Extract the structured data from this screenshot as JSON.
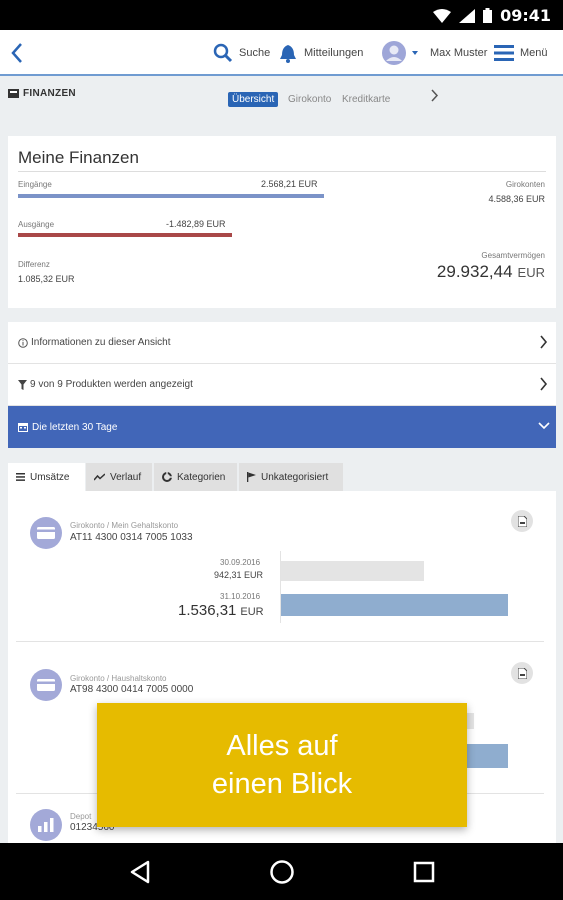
{
  "status_bar": {
    "time": "09:41"
  },
  "header": {
    "search_label": "Suche",
    "messages_label": "Mitteilungen",
    "user_name": "Max Muster",
    "menu_label": "Menü"
  },
  "subnav": {
    "section_label": "FINANZEN",
    "tabs": [
      "Übersicht",
      "Girokonto",
      "Kreditkarte"
    ]
  },
  "overview": {
    "title": "Meine Finanzen",
    "income_label": "Eingänge",
    "income_value": "2.568,21 EUR",
    "expenses_label": "Ausgänge",
    "expenses_value": "-1.482,89 EUR",
    "difference_label": "Differenz",
    "difference_value": "1.085,32 EUR",
    "giro_label": "Girokonten",
    "giro_value": "4.588,36 EUR",
    "total_label": "Gesamtvermögen",
    "total_value": "29.932,44",
    "total_currency": "EUR"
  },
  "rows": {
    "info": "Informationen zu dieser Ansicht",
    "products": "9 von 9 Produkten werden angezeigt",
    "period": "Die letzten 30 Tage"
  },
  "content_tabs": [
    "Umsätze",
    "Verlauf",
    "Kategorien",
    "Unkategorisiert"
  ],
  "accounts": [
    {
      "type": "Girokonto / Mein Gehaltskonto",
      "iban": "AT11 4300 0314 7005 1033",
      "prev_date": "30.09.2016",
      "prev_value": "942,31 EUR",
      "curr_date": "31.10.2016",
      "curr_value": "1.536,31",
      "curr_currency": "EUR"
    },
    {
      "type": "Girokonto / Haushaltskonto",
      "iban": "AT98 4300 0414 7005 0000"
    },
    {
      "type": "Depot",
      "iban": "01234560"
    }
  ],
  "banner": {
    "line1": "Alles auf",
    "line2": "einen Blick"
  },
  "colors": {
    "accent": "#2a65b5",
    "period_row": "#4166b8",
    "banner": "#e6bb00",
    "income_bar": "#7b93c8",
    "expense_bar": "#a94848"
  }
}
